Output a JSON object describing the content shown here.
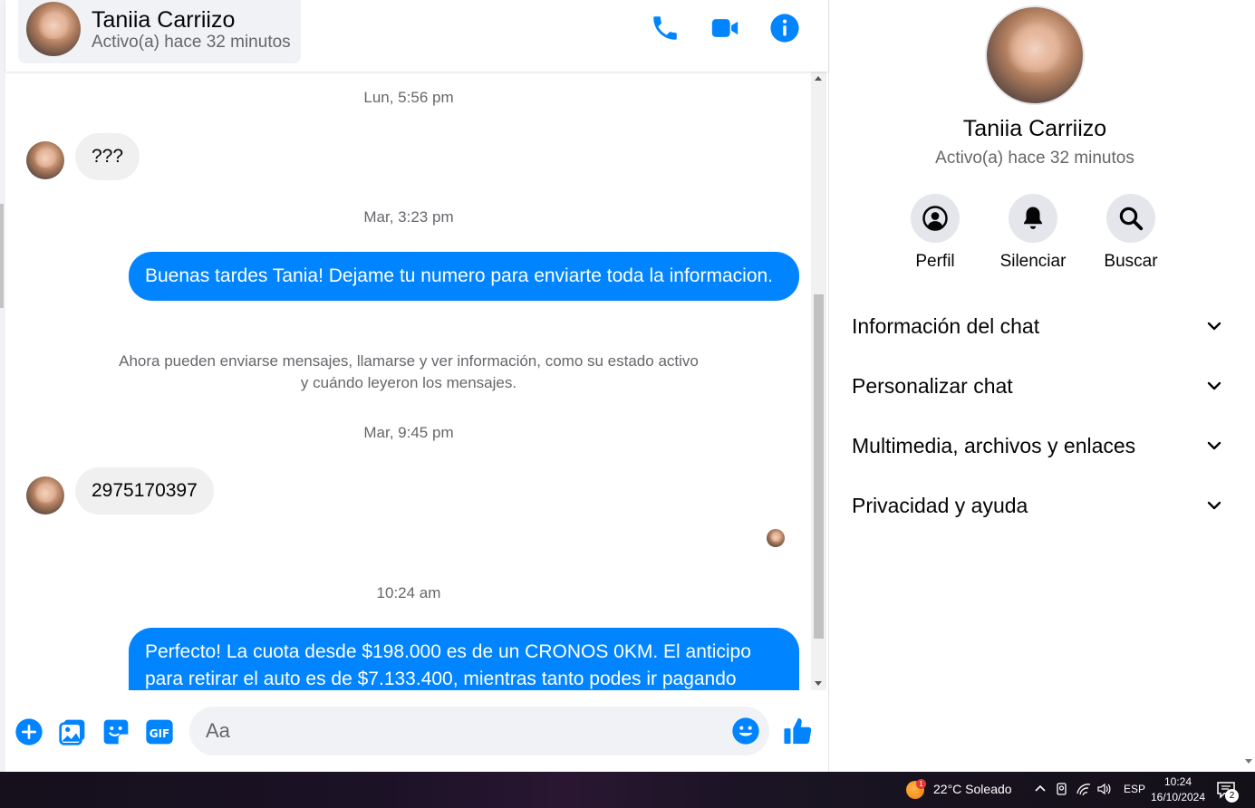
{
  "header": {
    "name": "Taniia Carriizo",
    "status": "Activo(a) hace 32 minutos"
  },
  "messages": {
    "ts1": "Lun, 5:56 pm",
    "in1": "???",
    "ts2": "Mar, 3:23 pm",
    "out1": "Buenas tardes Tania! Dejame tu numero para enviarte toda la informacion.",
    "system1": "Ahora pueden enviarse mensajes, llamarse y ver información, como su estado activo y cuándo leyeron los mensajes.",
    "ts3": "Mar, 9:45 pm",
    "in2": "2975170397",
    "ts4": "10:24 am",
    "out2": "Perfecto! La cuota desde $198.000 es de un CRONOS 0KM. El anticipo para retirar el auto es de $7.133.400, mientras tanto podes ir pagando"
  },
  "composer": {
    "placeholder": "Aa"
  },
  "info": {
    "name": "Taniia Carriizo",
    "status": "Activo(a) hace 32 minutos",
    "actions": {
      "profile": "Perfil",
      "mute": "Silenciar",
      "search": "Buscar"
    },
    "sections": [
      "Información del chat",
      "Personalizar chat",
      "Multimedia, archivos y enlaces",
      "Privacidad y ayuda"
    ]
  },
  "taskbar": {
    "weather": "22°C  Soleado",
    "weather_badge": "1",
    "language": "ESP",
    "time": "10:24",
    "date": "16/10/2024",
    "notification_count": "2"
  },
  "colors": {
    "accent": "#0084ff",
    "incoming_bubble": "#f0f0f0",
    "secondary_text": "#65676b"
  },
  "icons": {
    "header": [
      "phone-icon",
      "video-icon",
      "info-icon"
    ],
    "composer": [
      "plus-icon",
      "image-icon",
      "sticker-icon",
      "gif-icon",
      "emoji-icon",
      "like-icon"
    ],
    "info_actions": [
      "profile-icon",
      "bell-icon",
      "search-icon"
    ],
    "section": "chevron-down-icon"
  }
}
